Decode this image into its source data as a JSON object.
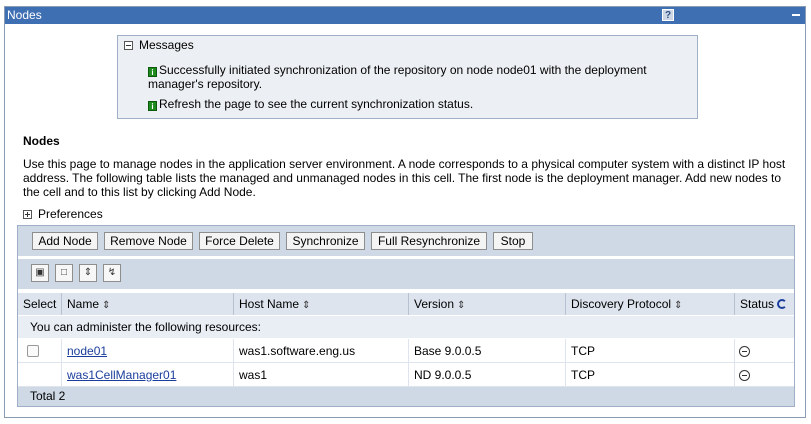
{
  "window": {
    "title": "Nodes",
    "help_label": "?"
  },
  "messages": {
    "header": "Messages",
    "items": [
      "Successfully initiated synchronization of the repository on node node01 with the deployment",
      "manager's repository.",
      "Refresh the page to see the current synchronization status."
    ],
    "info_icon_label": "i"
  },
  "page": {
    "title": "Nodes",
    "description_lines": [
      "Use this page to manage nodes in the application server environment. A node corresponds to a physical computer system with a distinct IP host",
      "address. The following table lists the managed and unmanaged nodes in this cell. The first node is the deployment manager. Add new nodes to",
      "the cell and to this list by clicking Add Node."
    ],
    "preferences_label": "Preferences"
  },
  "toolbar": {
    "add_node": "Add Node",
    "remove_node": "Remove Node",
    "force_delete": "Force Delete",
    "synchronize": "Synchronize",
    "full_resynchronize": "Full Resynchronize",
    "stop": "Stop"
  },
  "table_tools": [
    "select-all-icon",
    "deselect-all-icon",
    "show-filter-icon",
    "clear-filter-icon"
  ],
  "table": {
    "columns": [
      "Select",
      "Name",
      "Host Name",
      "Version",
      "Discovery Protocol",
      "Status"
    ],
    "sort_glyph": "⇕",
    "note": "You can administer the following resources:",
    "rows": [
      {
        "name": "node01",
        "host": "was1.software.eng.us",
        "version": "Base 9.0.0.5",
        "protocol": "TCP",
        "status": "synchronized"
      },
      {
        "name": "was1CellManager01",
        "host": "was1",
        "version": "ND 9.0.0.5",
        "protocol": "TCP",
        "status": "synchronized"
      }
    ],
    "total": "Total 2"
  }
}
